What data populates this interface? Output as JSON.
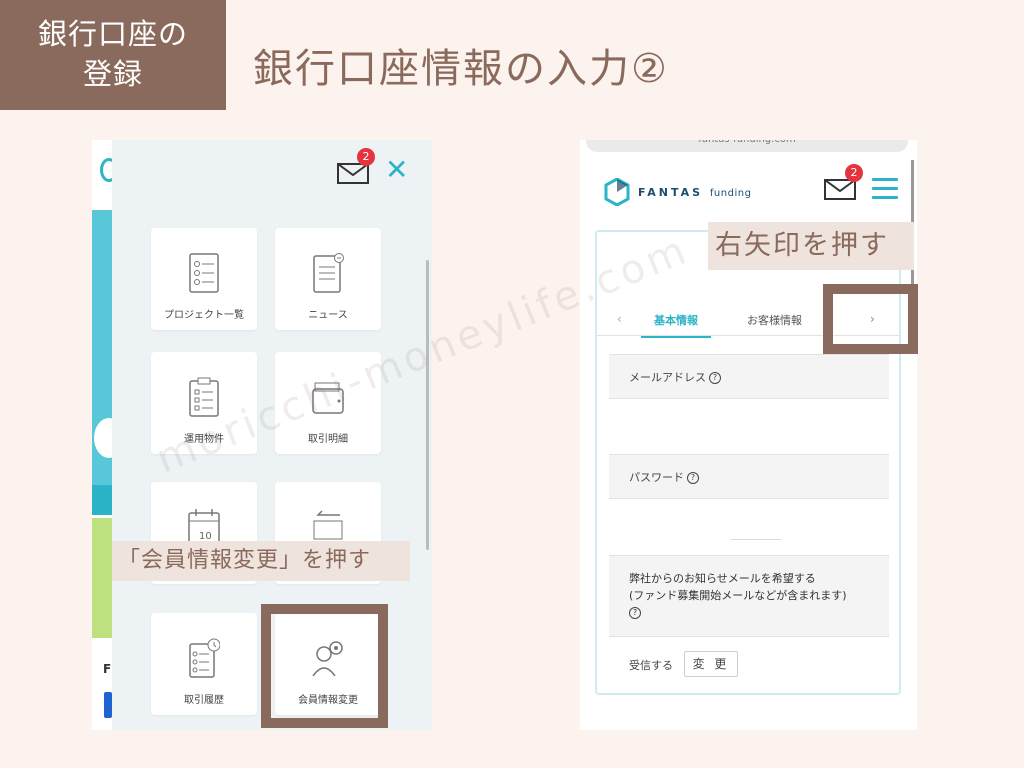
{
  "section_tag": {
    "line1": "銀行口座の",
    "line2": "登録"
  },
  "page_title": "銀行口座情報の入力②",
  "left_screen": {
    "mail_badge": "2",
    "menu_tiles": [
      {
        "label": "プロジェクト一覧",
        "icon": "list-icon"
      },
      {
        "label": "ニュース",
        "icon": "news-icon"
      },
      {
        "label": "運用物件",
        "icon": "clipboard-icon"
      },
      {
        "label": "取引明細",
        "icon": "wallet-icon"
      },
      {
        "label": "",
        "icon": "calendar-icon"
      },
      {
        "label": "",
        "icon": "transfer-icon"
      },
      {
        "label": "取引履歴",
        "icon": "history-icon"
      },
      {
        "label": "会員情報変更",
        "icon": "user-settings-icon"
      }
    ],
    "calendar_day": "10",
    "partial_text": "F",
    "caption": "「会員情報変更」を押す"
  },
  "right_screen": {
    "url": "fantas-funding.com",
    "brand": {
      "name": "FANTAS",
      "sub": "funding"
    },
    "mail_badge": "2",
    "caption": "右矢印を押す",
    "tabs": {
      "prev": "‹",
      "active": "基本情報",
      "next_tab": "お客様情報",
      "next": "›"
    },
    "fields": [
      {
        "label": "メールアドレス",
        "help": "?"
      },
      {
        "label": "パスワード",
        "help": "?"
      }
    ],
    "notify": {
      "line1": "弊社からのお知らせメールを希望する",
      "line2": "(ファンド募集開始メールなどが含まれます)",
      "help": "?"
    },
    "receive_label": "受信する",
    "change_button": "変 更"
  },
  "watermark": "moricchi-moneylife.com",
  "colors": {
    "accent": "#8a6a5c",
    "brand_cyan": "#2bb4c8",
    "badge_red": "#e5333f",
    "background": "#fdf3ee"
  }
}
